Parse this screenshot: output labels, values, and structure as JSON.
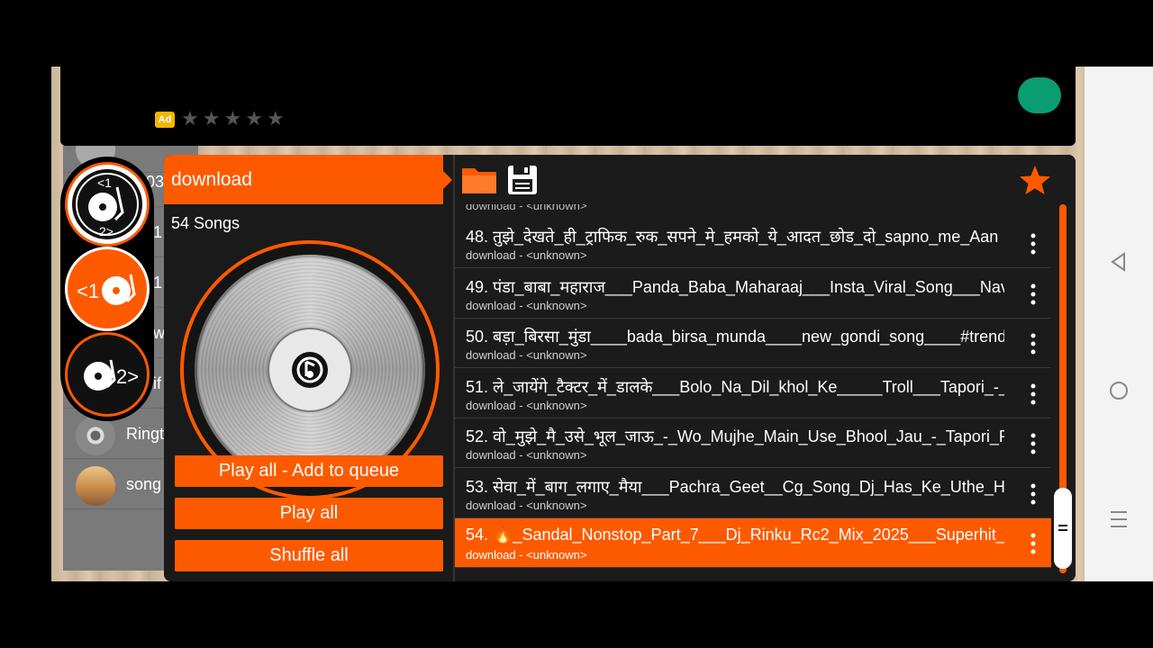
{
  "ad": {
    "badge": "Ad",
    "star_count": 5
  },
  "background_list": {
    "items": [
      {
        "label": ""
      },
      {
        "label": "03"
      },
      {
        "label": "1"
      },
      {
        "label": "1"
      },
      {
        "label": "w"
      },
      {
        "label": "if"
      },
      {
        "label": "Ringt"
      },
      {
        "label": "song"
      }
    ]
  },
  "decks": {
    "mix_label_top": "<1",
    "mix_label_bottom": "2>",
    "deck1_label": "<1",
    "deck2_label": "2>"
  },
  "dialog": {
    "folder_title": "download",
    "song_count": "54 Songs",
    "buttons": {
      "play_all_queue": "Play all - Add to queue",
      "play_all": "Play all",
      "shuffle_all": "Shuffle all"
    },
    "partial_subtitle": "download - <unknown>",
    "songs": [
      {
        "title": "48. तुझे_देखते_ही_ट्राफिक_रुक_सपने_मे_हमको_ये_आदत_छोड_दो_sapno_me_Aan",
        "subtitle": "download - <unknown>"
      },
      {
        "title": "49. पंडा_बाबा_महाराज___Panda_Baba_Maharaaj___Insta_Viral_Song___Nav",
        "subtitle": "download - <unknown>"
      },
      {
        "title": "50. बड़ा_बिरसा_मुंडा____bada_birsa_munda____new_gondi_song____#trend",
        "subtitle": "download - <unknown>"
      },
      {
        "title": "51. ले_जायेंगे_टैक्टर_में_डालके___Bolo_Na_Dil_khol_Ke_____Troll___Tapori_-_",
        "subtitle": "download - <unknown>"
      },
      {
        "title": "52. वो_मुझे_मै_उसे_भूल_जाऊ_-_Wo_Mujhe_Main_Use_Bhool_Jau_-_Tapori_R",
        "subtitle": "download - <unknown>"
      },
      {
        "title": "53. सेवा_में_बाग_लगाए_मैया___Pachra_Geet__Cg_Song_Dj_Has_Ke_Uthe_Ha",
        "subtitle": "download - <unknown>"
      },
      {
        "title": "54. 🔥_Sandal_Nonstop_Part_7___Dj_Rinku_Rc2_Mix_2025___Superhit_",
        "subtitle": "download - <unknown>"
      }
    ],
    "selected_index": 6
  },
  "colors": {
    "accent": "#fd5a00",
    "ad_green": "#0a9d72",
    "ad_badge": "#f5b400"
  }
}
